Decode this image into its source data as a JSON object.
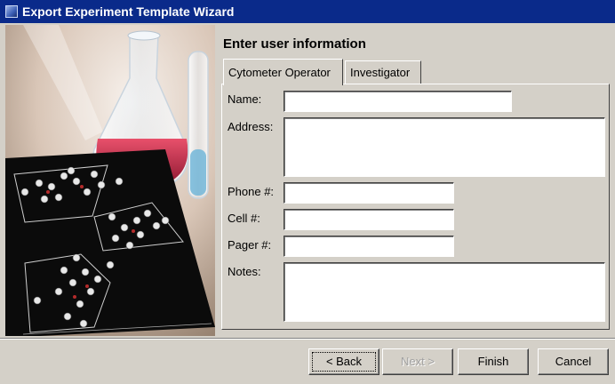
{
  "window": {
    "title": "Export Experiment Template Wizard",
    "icon": "wizard-window-icon"
  },
  "page": {
    "heading": "Enter user information"
  },
  "tabs": [
    {
      "label": "Cytometer Operator",
      "active": true
    },
    {
      "label": "Investigator",
      "active": false
    }
  ],
  "form": {
    "name_label": "Name:",
    "name_value": "",
    "address_label": "Address:",
    "address_value": "",
    "phone_label": "Phone #:",
    "phone_value": "",
    "cell_label": "Cell #:",
    "cell_value": "",
    "pager_label": "Pager #:",
    "pager_value": "",
    "notes_label": "Notes:",
    "notes_value": ""
  },
  "buttons": {
    "back": "< Back",
    "next": "Next >",
    "finish": "Finish",
    "cancel": "Cancel"
  },
  "colors": {
    "titlebar": "#0a2a8a",
    "dialog_bg": "#d4d0c8"
  }
}
